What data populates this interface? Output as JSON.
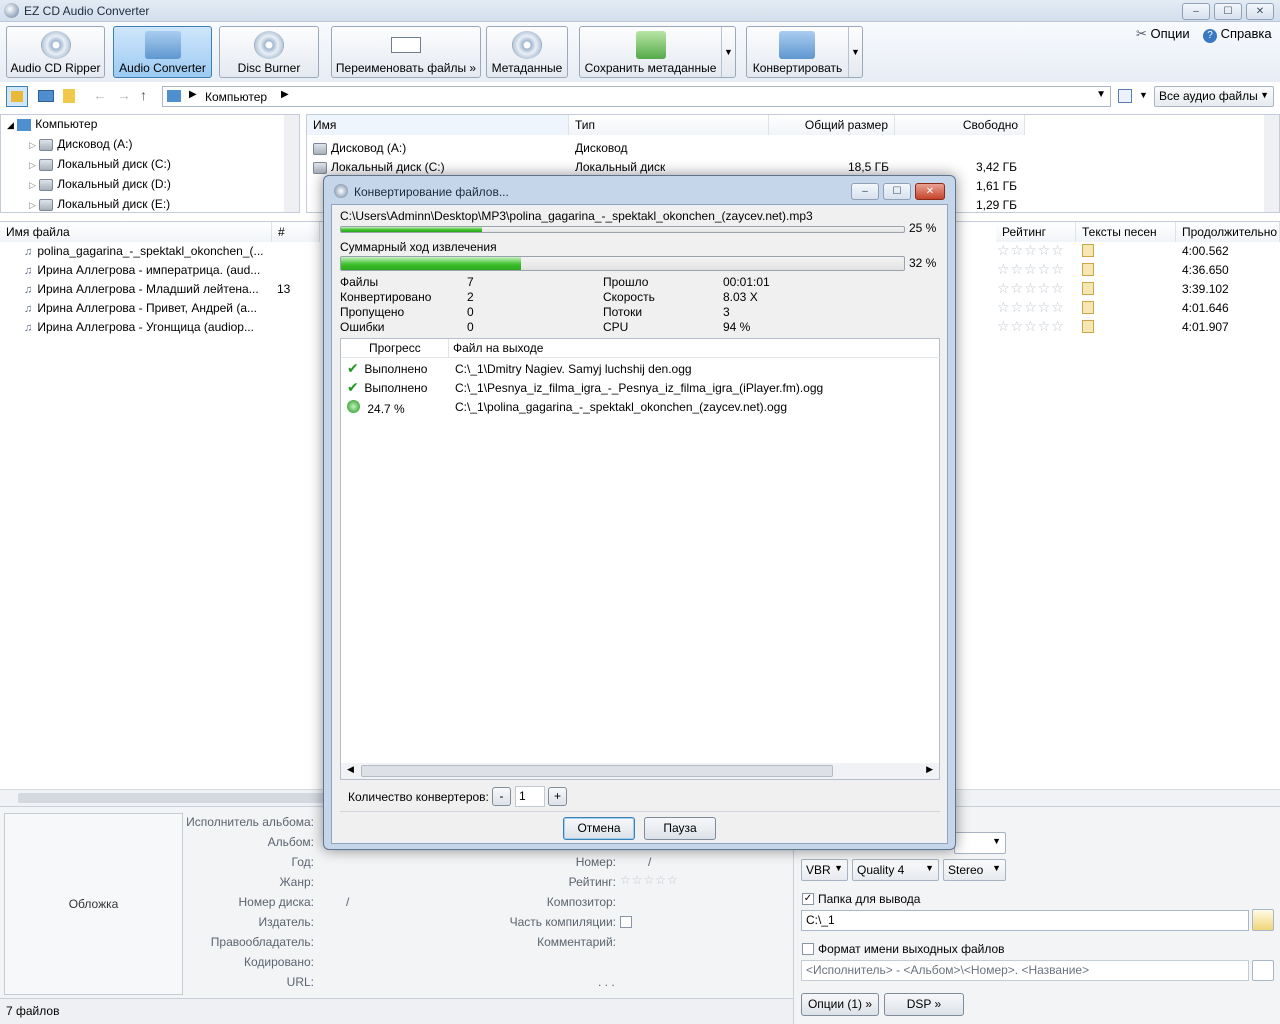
{
  "window": {
    "title": "EZ CD Audio Converter",
    "min": "‒",
    "max": "☐",
    "close": "✕"
  },
  "toolbar": {
    "ripper": "Audio CD Ripper",
    "converter": "Audio Converter",
    "burner": "Disc Burner",
    "rename": "Переименовать файлы »",
    "metadata": "Метаданные",
    "save_metadata": "Сохранить метаданные",
    "convert": "Конвертировать",
    "options": "Опции",
    "help": "Справка"
  },
  "nav": {
    "address": "Компьютер",
    "filter": "Все аудио файлы"
  },
  "tree": {
    "root": "Компьютер",
    "items": [
      "Дисковод (A:)",
      "Локальный диск (C:)",
      "Локальный диск (D:)",
      "Локальный диск (E:)"
    ]
  },
  "drives": {
    "headers": {
      "name": "Имя",
      "type": "Тип",
      "total": "Общий размер",
      "free": "Свободно"
    },
    "rows": [
      {
        "name": "Дисковод (A:)",
        "type": "Дисковод",
        "total": "",
        "free": ""
      },
      {
        "name": "Локальный диск (C:)",
        "type": "Локальный диск",
        "total": "18,5 ГБ",
        "free": "3,42 ГБ"
      },
      {
        "name": "",
        "type": "",
        "total": "",
        "free": "1,61 ГБ"
      },
      {
        "name": "",
        "type": "",
        "total": "",
        "free": "1,29 ГБ"
      }
    ]
  },
  "files": {
    "headers": {
      "filename": "Имя файла",
      "num": "#",
      "rating": "Рейтинг",
      "lyrics": "Тексты песен",
      "duration": "Продолжительно"
    },
    "rows": [
      {
        "name": "polina_gagarina_-_spektakl_okonchen_(...",
        "num": "",
        "duration": "4:00.562"
      },
      {
        "name": "Ирина Аллегрова - императрица. (aud...",
        "num": "",
        "duration": "4:36.650"
      },
      {
        "name": "Ирина Аллегрова - Младший лейтена...",
        "num": "13",
        "duration": "3:39.102"
      },
      {
        "name": "Ирина Аллегрова - Привет, Андрей (a...",
        "num": "",
        "duration": "4:01.646"
      },
      {
        "name": "Ирина Аллегрова - Угонщица (audiop...",
        "num": "",
        "duration": "4:01.907"
      }
    ],
    "stars": "☆☆☆☆☆"
  },
  "meta": {
    "cover": "Обложка",
    "album_artist": "Исполнитель альбома:",
    "album": "Альбом:",
    "year": "Год:",
    "genre": "Жанр:",
    "disc_no": "Номер диска:",
    "disc_no_value": "/",
    "publisher": "Издатель:",
    "copyright": "Правообладатель:",
    "encoded": "Кодировано:",
    "url": "URL:",
    "number": "Номер:",
    "number_value": "/",
    "rating": "Рейтинг:",
    "composer": "Композитор:",
    "compilation": "Часть компиляции:",
    "comment": "Комментарий:",
    "dots": ". . ."
  },
  "output": {
    "vbr": "VBR",
    "quality": "Quality 4",
    "stereo": "Stereo",
    "folder_label": "Папка для вывода",
    "folder": "C:\\_1",
    "format_label": "Формат имени выходных файлов",
    "format": "<Исполнитель> - <Альбом>\\<Номер>. <Название>",
    "options_btn": "Опции (1) »",
    "dsp_btn": "DSP »"
  },
  "status": {
    "count": "7 файлов"
  },
  "dialog": {
    "title": "Конвертирование файлов...",
    "current_file": "C:\\Users\\Adminn\\Desktop\\MP3\\polina_gagarina_-_spektakl_okonchen_(zaycev.net).mp3",
    "file_progress": 25,
    "file_progress_text": "25 %",
    "total_label": "Суммарный ход извлечения",
    "total_progress": 32,
    "total_progress_text": "32 %",
    "stats": {
      "files_l": "Файлы",
      "files_v": "7",
      "converted_l": "Конвертировано",
      "converted_v": "2",
      "skipped_l": "Пропущено",
      "skipped_v": "0",
      "errors_l": "Ошибки",
      "errors_v": "0",
      "elapsed_l": "Прошло",
      "elapsed_v": "00:01:01",
      "speed_l": "Скорость",
      "speed_v": "8.03 X",
      "threads_l": "Потоки",
      "threads_v": "3",
      "cpu_l": "CPU",
      "cpu_v": "94 %"
    },
    "list_headers": {
      "progress": "Прогресс",
      "output": "Файл на выходе"
    },
    "list": [
      {
        "progress": "Выполнено",
        "file": "C:\\_1\\Dmitry Nagiev. Samyj luchshij den.ogg",
        "done": true
      },
      {
        "progress": "Выполнено",
        "file": "C:\\_1\\Pesnya_iz_filma_igra_-_Pesnya_iz_filma_igra_(iPlayer.fm).ogg",
        "done": true
      },
      {
        "progress": "24.7 %",
        "file": "C:\\_1\\polina_gagarina_-_spektakl_okonchen_(zaycev.net).ogg",
        "done": false
      }
    ],
    "converters_label": "Количество конвертеров:",
    "converters_value": "1",
    "minus": "-",
    "plus": "+",
    "cancel": "Отмена",
    "pause": "Пауза"
  }
}
